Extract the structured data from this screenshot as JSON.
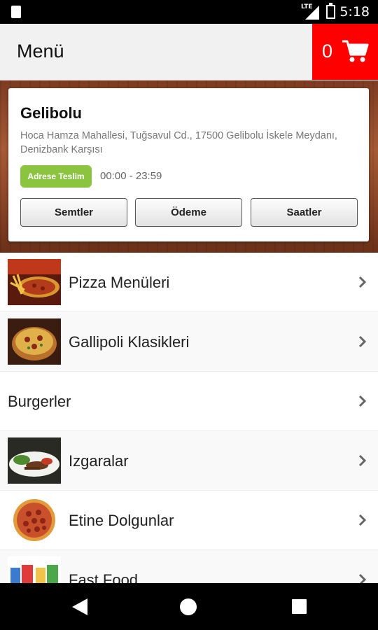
{
  "status_bar": {
    "network": "LTE",
    "time": "5:18"
  },
  "header": {
    "title": "Menü",
    "cart_count": "0"
  },
  "branch": {
    "name": "Gelibolu",
    "address": "Hoca Hamza Mahallesi, Tuğsavul Cd., 17500 Gelibolu İskele Meydanı, Denizbank Karşısı",
    "delivery_badge": "Adrese Teslim",
    "hours": "00:00 - 23:59",
    "buttons": [
      "Semtler",
      "Ödeme",
      "Saatler"
    ]
  },
  "categories": [
    {
      "label": "Pizza Menüleri",
      "image": "pizza-fries-photo"
    },
    {
      "label": "Gallipoli Klasikleri",
      "image": "deep-pizza-photo"
    },
    {
      "label": "Burgerler",
      "image": null
    },
    {
      "label": "Izgaralar",
      "image": "grill-plate-photo"
    },
    {
      "label": "Etine Dolgunlar",
      "image": "pepperoni-pizza-photo"
    },
    {
      "label": "Fast Food",
      "image": "fast-food-photo"
    }
  ],
  "colors": {
    "cart_bg": "#ff0000",
    "badge_bg": "#8bc53f",
    "appbar_bg": "#f1f1f1"
  }
}
